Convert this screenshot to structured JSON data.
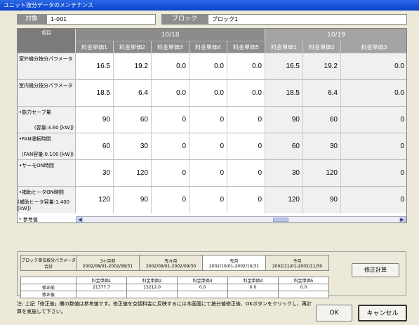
{
  "window": {
    "title": "ユニット按分データのメンテナンス"
  },
  "info": {
    "target_label": "対象",
    "target_value": "1-001",
    "block_label": "ブロック",
    "block_value": "ブロック1"
  },
  "grid": {
    "corner_label": "項目",
    "dates": [
      "10/18",
      "10/19"
    ],
    "columns": [
      "料金単価1",
      "料金単価2",
      "料金単価3",
      "料金単価4",
      "料金単価5",
      "料金単価1",
      "料金単価2",
      "料金単価3"
    ],
    "rows": [
      {
        "label": "室外機分按分パラメータ",
        "sub": "",
        "values": [
          "16.5",
          "19.2",
          "0.0",
          "0.0",
          "0.0",
          "16.5",
          "19.2",
          "0.0"
        ]
      },
      {
        "label": "室内機分按分パラメータ",
        "sub": "",
        "values": [
          "18.5",
          "6.4",
          "0.0",
          "0.0",
          "0.0",
          "18.5",
          "6.4",
          "0.0"
        ]
      },
      {
        "label": "•能力セーブ量",
        "sub": "(容量:3.60 [kW])",
        "values": [
          "90",
          "60",
          "0",
          "0",
          "0",
          "90",
          "60",
          "0"
        ]
      },
      {
        "label": "•FAN運転時間",
        "sub": "(FAN容量:0.100 [kW])",
        "values": [
          "60",
          "30",
          "0",
          "0",
          "0",
          "60",
          "30",
          "0"
        ]
      },
      {
        "label": "•サーモON時間",
        "sub": "",
        "values": [
          "30",
          "120",
          "0",
          "0",
          "0",
          "30",
          "120",
          "0"
        ]
      },
      {
        "label": "•補助ヒータON時間",
        "sub": "(補助ヒータ容量:1.400 [kW])",
        "values": [
          "120",
          "90",
          "0",
          "0",
          "0",
          "120",
          "90",
          "0"
        ]
      }
    ],
    "reference_note": "* 参考値"
  },
  "summary": {
    "row_label": "ブロック単位按分パラメータ合計",
    "periods": [
      {
        "name": "3ヶ月前",
        "range": "2002/08/01-2002/08/31"
      },
      {
        "name": "先々月",
        "range": "2002/09/01-2002/09/30"
      },
      {
        "name": "先月",
        "range": "2002/10/01-2002/10/31"
      },
      {
        "name": "今月",
        "range": "2002/11/01-2002/11/30"
      }
    ],
    "columns": [
      "料金単価1",
      "料金単価2",
      "料金単価3",
      "料金単価4",
      "料金単価5"
    ],
    "before_label": "修正前",
    "after_label": "修正後",
    "before_values": [
      "21377.7",
      "13212.0",
      "0.0",
      "0.0",
      "0.0"
    ],
    "after_values": [
      "",
      "",
      "",
      "",
      ""
    ]
  },
  "buttons": {
    "recalc": "修正計算",
    "ok": "OK",
    "cancel": "キャンセル"
  },
  "footer_note": "注: 上記「修正後」欄の数値は参考値です。修正値を空調料金に反映するには本画面にて按分値修正後、OKボタンをクリックし、再計算を実施して下さい。",
  "colors": {
    "title_bar": "#0a42c8",
    "header_gray": "#8c8c8c",
    "header_alt_gray": "#a3a3a3"
  }
}
